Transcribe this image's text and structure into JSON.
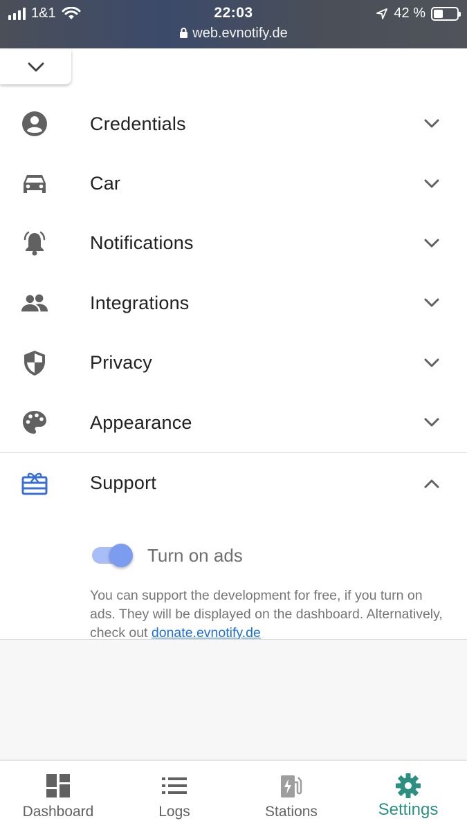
{
  "status_bar": {
    "carrier": "1&1",
    "time": "22:03",
    "url": "web.evnotify.de",
    "battery_text": "42 %"
  },
  "settings": {
    "sections": [
      {
        "label": "Credentials",
        "icon": "account-circle-icon",
        "expanded": false
      },
      {
        "label": "Car",
        "icon": "car-icon",
        "expanded": false
      },
      {
        "label": "Notifications",
        "icon": "bell-ringing-icon",
        "expanded": false
      },
      {
        "label": "Integrations",
        "icon": "people-icon",
        "expanded": false
      },
      {
        "label": "Privacy",
        "icon": "shield-icon",
        "expanded": false
      },
      {
        "label": "Appearance",
        "icon": "palette-icon",
        "expanded": false
      },
      {
        "label": "Support",
        "icon": "card-giftcard-icon",
        "expanded": true
      }
    ],
    "support": {
      "toggle_label": "Turn on ads",
      "toggle_on": true,
      "text": "You can support the development for free, if you turn on ads. They will be displayed on the dashboard. Alternatively, check out",
      "link_text": "donate.evnotify.de"
    }
  },
  "bottom_nav": {
    "items": [
      {
        "label": "Dashboard",
        "icon": "dashboard-icon"
      },
      {
        "label": "Logs",
        "icon": "list-icon"
      },
      {
        "label": "Stations",
        "icon": "ev-station-icon"
      },
      {
        "label": "Settings",
        "icon": "gear-icon"
      }
    ],
    "active": "Settings"
  },
  "colors": {
    "accent_active": "#2d8f82",
    "support_icon": "#3a6fd6",
    "toggle_on": "#7c9cf0",
    "link": "#1e6fd9",
    "icon_grey": "#616161"
  }
}
